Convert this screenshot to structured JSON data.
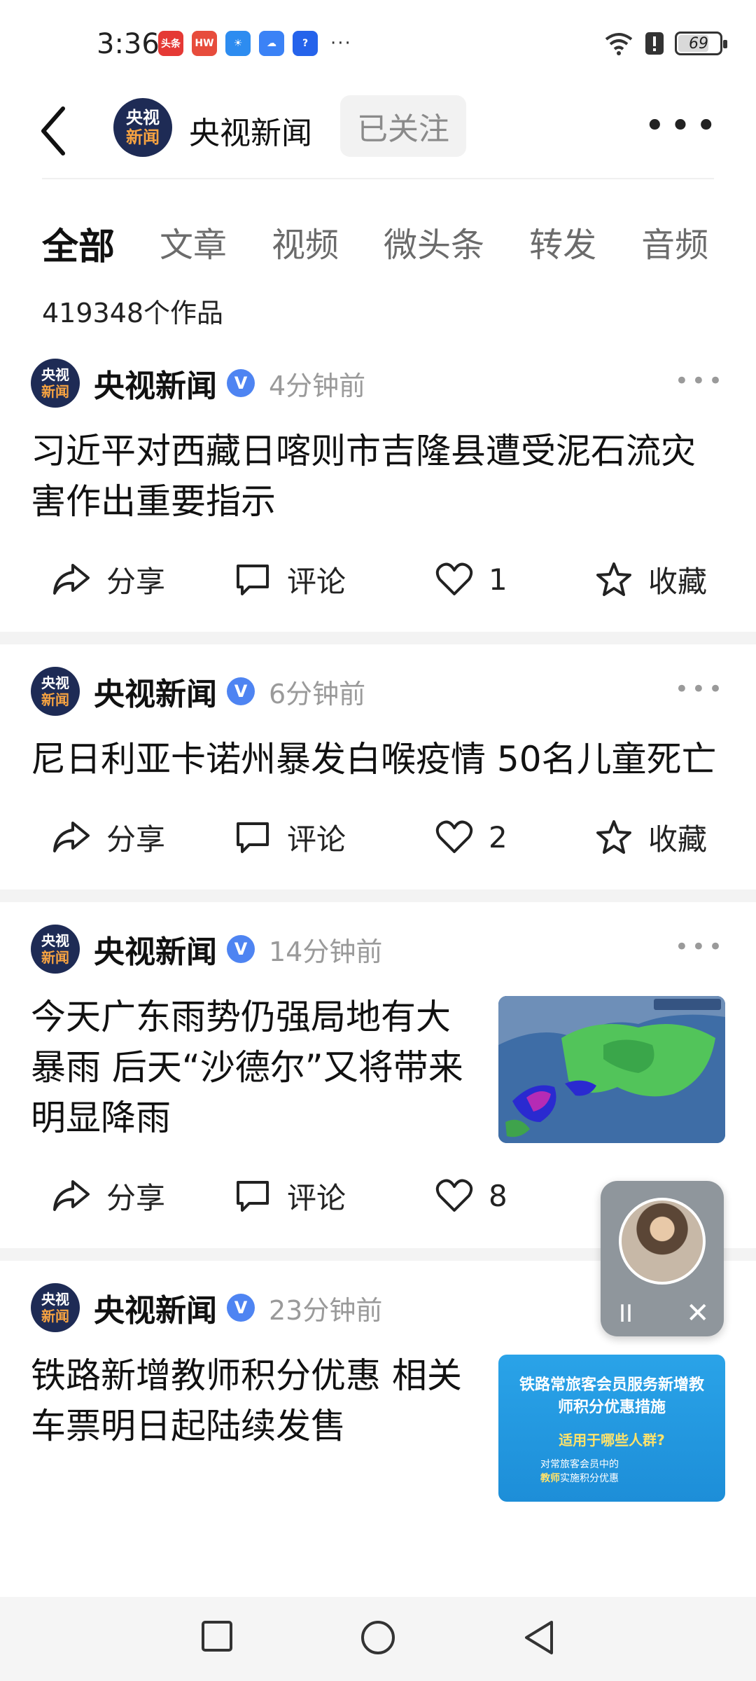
{
  "status_bar": {
    "time": "3:36",
    "app_icons": [
      {
        "name": "toutiao",
        "label": "头条",
        "color": "#e53935"
      },
      {
        "name": "huawei",
        "label": "HW",
        "color": "#e74c3c"
      },
      {
        "name": "weather",
        "label": "☀",
        "color": "#2d8cf0"
      },
      {
        "name": "cloud",
        "label": "☁",
        "color": "#3b82f6"
      },
      {
        "name": "tips",
        "label": "?",
        "color": "#2563eb"
      }
    ],
    "more": "···",
    "battery": "69"
  },
  "header": {
    "avatar_line1": "央视",
    "avatar_line2": "新闻",
    "name": "央视新闻",
    "follow_label": "已关注",
    "more": "•••"
  },
  "tabs": [
    "全部",
    "文章",
    "视频",
    "微头条",
    "转发",
    "音频"
  ],
  "works_count": "419348个作品",
  "feed": [
    {
      "author": "央视新闻",
      "verified": "V",
      "time": "4分钟前",
      "headline": "习近平对西藏日喀则市吉隆县遭受泥石流灾害作出重要指示",
      "share": "分享",
      "comment": "评论",
      "likes": "1",
      "favorite": "收藏"
    },
    {
      "author": "央视新闻",
      "verified": "V",
      "time": "6分钟前",
      "headline": "尼日利亚卡诺州暴发白喉疫情 50名儿童死亡",
      "share": "分享",
      "comment": "评论",
      "likes": "2",
      "favorite": "收藏"
    },
    {
      "author": "央视新闻",
      "verified": "V",
      "time": "14分钟前",
      "headline": "今天广东雨势仍强局地有大暴雨 后天“沙德尔”又将带来明显降雨",
      "share": "分享",
      "comment": "评论",
      "likes": "8"
    },
    {
      "author": "央视新闻",
      "verified": "V",
      "time": "23分钟前",
      "headline": "铁路新增教师积分优惠 相关车票明日起陆续发售",
      "thumb_title": "铁路常旅客会员服务新增教师积分优惠措施",
      "thumb_question": "适用于哪些人群?",
      "thumb_note_1": "对常旅客会员中的",
      "thumb_note_2": "教师",
      "thumb_note_3": "实施积分优惠"
    }
  ],
  "float_player": {
    "pause": "II",
    "close": "✕"
  }
}
